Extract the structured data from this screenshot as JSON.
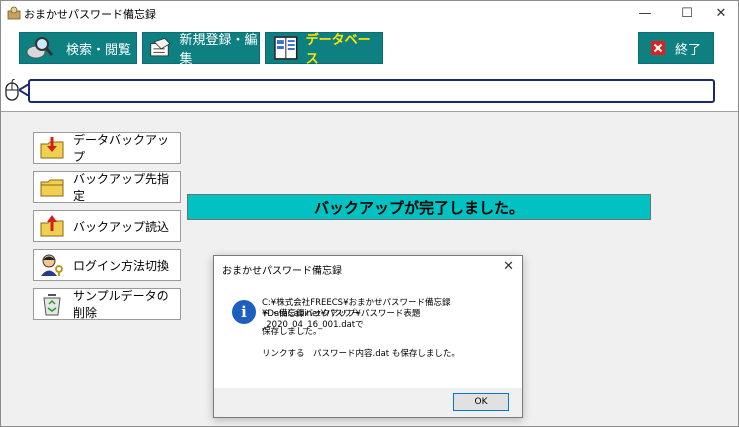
{
  "window": {
    "title": "おまかせパスワード備忘録"
  },
  "titlebar": {
    "minimize": "—",
    "maximize": "☐",
    "close": "✕"
  },
  "toolbar": {
    "search_label": "検索・閲覧",
    "register_label": "新規登録・編集",
    "database_label": "データベース",
    "exit_label": "終了",
    "colors": {
      "button_bg": "#0e8082",
      "active_text": "#ffe600",
      "exit_icon_bg": "#e02020"
    }
  },
  "sidebar": {
    "items": [
      {
        "label": "データバックアップ",
        "icon": "folder-download-icon"
      },
      {
        "label": "バックアップ先指定",
        "icon": "folder-icon"
      },
      {
        "label": "バックアップ読込",
        "icon": "folder-upload-icon"
      },
      {
        "label": "ログイン方法切換",
        "icon": "user-key-icon"
      },
      {
        "label": "サンプルデータの削除",
        "icon": "recycle-bin-icon"
      }
    ]
  },
  "main": {
    "status_banner": "バックアップが完了しました。",
    "banner_color": "#00c2c2"
  },
  "dialog": {
    "title": "おまかせパスワード備忘録",
    "close": "✕",
    "path_line1": "C:¥株式会社FREECS¥おまかせパスワード備忘録¥DataCabinet¥パスワー",
    "path_line2": "ド・備忘録バックアップ¥パスワード表題_2020_04_16_001.datで",
    "saved_text": "保存しました。",
    "link_text": "リンクする　パスワード内容.dat も保存しました。",
    "ok_label": "OK",
    "icon": "info-icon"
  }
}
